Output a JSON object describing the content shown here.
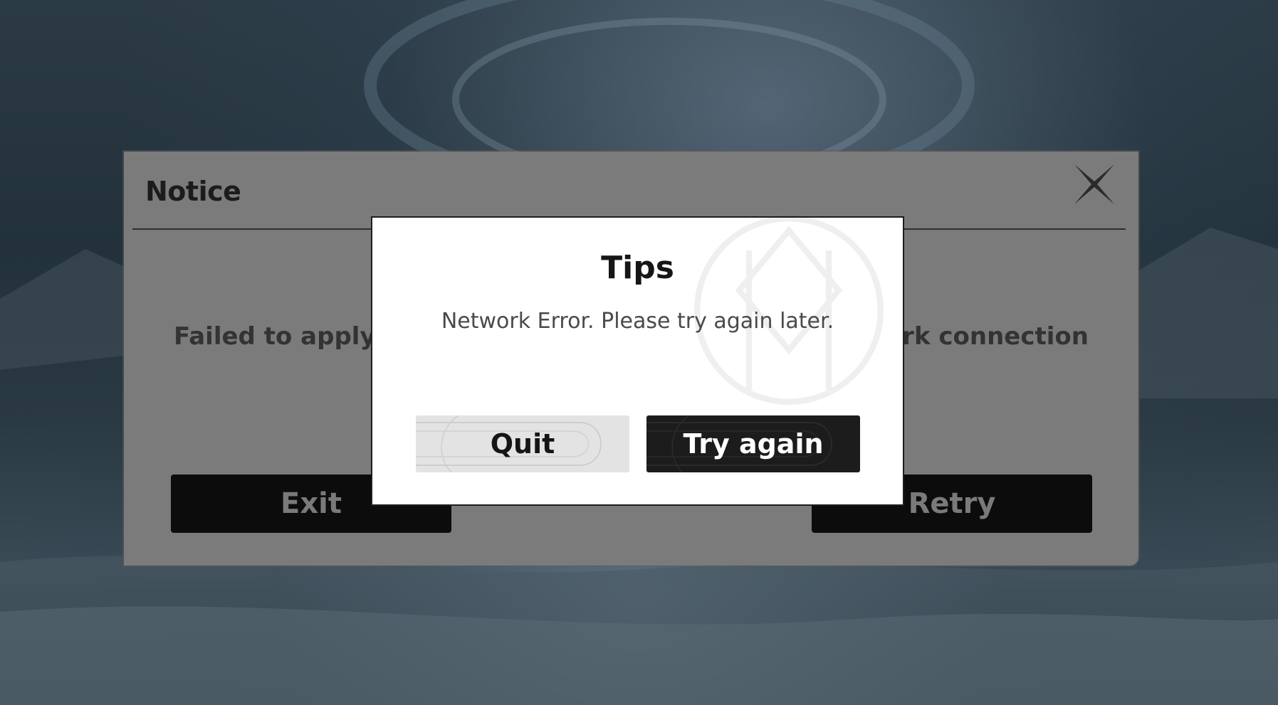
{
  "notice": {
    "title": "Notice",
    "message_left": "Failed to apply R",
    "message_right": "ork connection",
    "exit_label": "Exit",
    "retry_label": "Retry",
    "close_icon": "close-x-icon"
  },
  "tips": {
    "title": "Tips",
    "message": "Network Error. Please try again later.",
    "quit_label": "Quit",
    "try_again_label": "Try again"
  },
  "colors": {
    "dialog_bg": "#ffffff",
    "primary_button": "#1c1c1c",
    "secondary_button": "#e3e3e3",
    "overlay_dialog": "#7b7b7b"
  }
}
